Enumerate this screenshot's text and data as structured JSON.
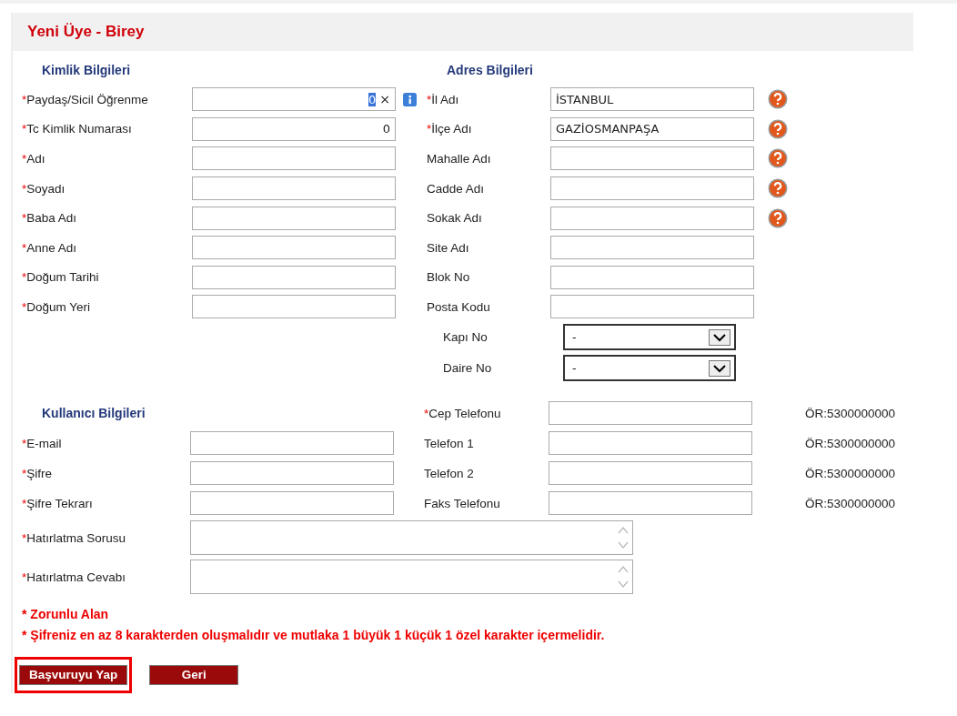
{
  "title": "Yeni Üye - Birey",
  "identity": {
    "heading": "Kimlik Bilgileri",
    "fields": [
      {
        "mark": "*",
        "label": "Paydaş/Sicil Öğrenme",
        "value": "0",
        "clear": "×",
        "info": true
      },
      {
        "mark": "*",
        "label": "Tc Kimlik Numarası",
        "value": "0",
        "info": false
      },
      {
        "mark": "*",
        "label": "Adı",
        "info": false
      },
      {
        "mark": "*",
        "label": "Soyadı",
        "info": false
      },
      {
        "mark": "*",
        "label": "Baba Adı",
        "info": false
      },
      {
        "mark": "*",
        "label": "Anne Adı",
        "info": false
      },
      {
        "mark": "*",
        "label": "Doğum Tarihi",
        "info": false
      },
      {
        "mark": "*",
        "label": "Doğum Yeri",
        "info": false
      }
    ]
  },
  "address": {
    "heading": "Adres Bilgileri",
    "fields": [
      {
        "mark": "*",
        "label": "İl Adı",
        "value": "İSTANBUL",
        "help": true
      },
      {
        "mark": "*",
        "label": "İlçe Adı",
        "value": "GAZİOSMANPAŞA",
        "help": true
      },
      {
        "label": "Mahalle Adı",
        "help": true
      },
      {
        "label": "Cadde Adı",
        "help": true
      },
      {
        "label": "Sokak Adı",
        "help": true
      },
      {
        "label": "Site Adı",
        "help": false
      },
      {
        "label": "Blok No",
        "help": false
      },
      {
        "label": "Posta Kodu",
        "help": false
      }
    ],
    "selects": [
      {
        "label": "Kapı No",
        "value": "-"
      },
      {
        "label": "Daire No",
        "value": "-"
      }
    ]
  },
  "user": {
    "heading": "Kullanıcı Bilgileri",
    "fields": [
      {
        "mark": "*",
        "label": "E-mail",
        "kind": "text"
      },
      {
        "mark": "*",
        "label": "Şifre",
        "kind": "text"
      },
      {
        "mark": "*",
        "label": "Şifre Tekrarı",
        "kind": "text"
      },
      {
        "mark": "*",
        "label": "Hatırlatma Sorusu",
        "kind": "textarea"
      },
      {
        "mark": "*",
        "label": "Hatırlatma Cevabı",
        "kind": "textarea"
      }
    ]
  },
  "phones": [
    {
      "mark": "*",
      "label": "Cep Telefonu",
      "hint": "ÖR:5300000000"
    },
    {
      "label": "Telefon 1",
      "hint": "ÖR:5300000000"
    },
    {
      "label": "Telefon 2",
      "hint": "ÖR:5300000000"
    },
    {
      "label": "Faks Telefonu",
      "hint": "ÖR:5300000000"
    }
  ],
  "notes": [
    "* Zorunlu Alan",
    "* Şifreniz en az 8 karakterden oluşmalıdır ve mutlaka 1 büyük 1 küçük 1 özel karakter içermelidir."
  ],
  "buttons": [
    {
      "label": "Başvuruyu Yap",
      "highlighted": true
    },
    {
      "label": "Geri",
      "highlighted": false
    }
  ]
}
